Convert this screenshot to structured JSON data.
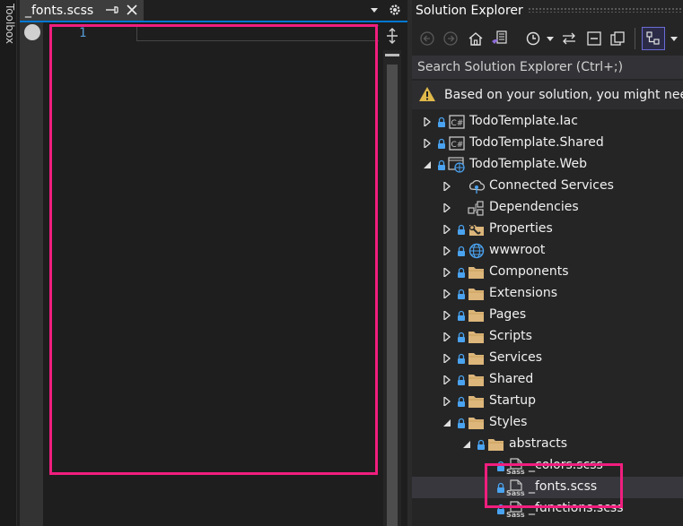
{
  "toolbox": {
    "label": "Toolbox"
  },
  "editor": {
    "tab_title": "_fonts.scss",
    "line_number": "1"
  },
  "solution_explorer": {
    "title": "Solution Explorer",
    "search_placeholder": "Search Solution Explorer (Ctrl+;)",
    "info_text": "Based on your solution, you might need",
    "tree": [
      {
        "label": "TodoTemplate.Iac",
        "level": 0,
        "expander": "collapsed",
        "lock": true,
        "icon": "csharp-project-icon"
      },
      {
        "label": "TodoTemplate.Shared",
        "level": 0,
        "expander": "collapsed",
        "lock": true,
        "icon": "csharp-project-icon"
      },
      {
        "label": "TodoTemplate.Web",
        "level": 0,
        "expander": "expanded",
        "lock": true,
        "icon": "web-project-icon"
      },
      {
        "label": "Connected Services",
        "level": 1,
        "expander": "collapsed",
        "lock": false,
        "icon": "connected-services-icon"
      },
      {
        "label": "Dependencies",
        "level": 1,
        "expander": "collapsed",
        "lock": false,
        "icon": "dependencies-icon"
      },
      {
        "label": "Properties",
        "level": 1,
        "expander": "collapsed",
        "lock": true,
        "icon": "properties-folder-icon"
      },
      {
        "label": "wwwroot",
        "level": 1,
        "expander": "collapsed",
        "lock": true,
        "icon": "globe-icon"
      },
      {
        "label": "Components",
        "level": 1,
        "expander": "collapsed",
        "lock": true,
        "icon": "folder-icon"
      },
      {
        "label": "Extensions",
        "level": 1,
        "expander": "collapsed",
        "lock": true,
        "icon": "folder-icon"
      },
      {
        "label": "Pages",
        "level": 1,
        "expander": "collapsed",
        "lock": true,
        "icon": "folder-icon"
      },
      {
        "label": "Scripts",
        "level": 1,
        "expander": "collapsed",
        "lock": true,
        "icon": "folder-icon"
      },
      {
        "label": "Services",
        "level": 1,
        "expander": "collapsed",
        "lock": true,
        "icon": "folder-icon"
      },
      {
        "label": "Shared",
        "level": 1,
        "expander": "collapsed",
        "lock": true,
        "icon": "folder-icon"
      },
      {
        "label": "Startup",
        "level": 1,
        "expander": "collapsed",
        "lock": true,
        "icon": "folder-icon"
      },
      {
        "label": "Styles",
        "level": 1,
        "expander": "expanded",
        "lock": true,
        "icon": "folder-icon"
      },
      {
        "label": "abstracts",
        "level": 2,
        "expander": "expanded",
        "lock": true,
        "icon": "folder-icon"
      },
      {
        "label": "_colors.scss",
        "level": 3,
        "expander": "none",
        "lock": true,
        "icon": "sass-file-icon",
        "icon_text": "Sass"
      },
      {
        "label": "_fonts.scss",
        "level": 3,
        "expander": "none",
        "lock": true,
        "icon": "sass-file-icon",
        "icon_text": "Sass",
        "selected": true
      },
      {
        "label": "_functions.scss",
        "level": 3,
        "expander": "none",
        "lock": true,
        "icon": "sass-file-icon",
        "icon_text": "Sass"
      }
    ]
  },
  "colors": {
    "accent": "#0078d4",
    "highlight": "#f01e7e",
    "warning": "#e0b94a",
    "line_number": "#569cd6"
  }
}
